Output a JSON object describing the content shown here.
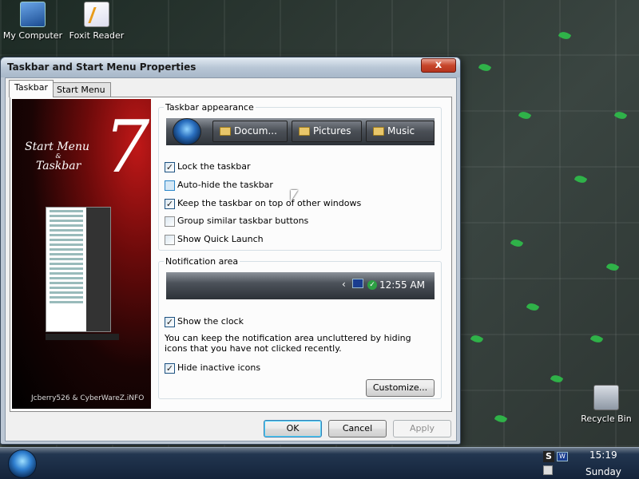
{
  "desktop": {
    "icons": [
      {
        "label": "My Computer",
        "icon": "my-computer-icon"
      },
      {
        "label": "Foxit Reader",
        "icon": "foxit-reader-icon"
      },
      {
        "label": "Recycle Bin",
        "icon": "recycle-bin-icon"
      }
    ]
  },
  "dialog": {
    "title": "Taskbar and Start Menu Properties",
    "close_label": "x",
    "tabs": [
      {
        "label": "Taskbar",
        "active": true
      },
      {
        "label": "Start Menu",
        "active": false
      }
    ],
    "preview": {
      "big_number": "7",
      "title_line1": "Start Menu",
      "title_amp": "&",
      "title_line2": "Taskbar",
      "credit": "Jcberry526 & CyberWareZ.iNFO"
    },
    "taskbar_appearance": {
      "label": "Taskbar appearance",
      "preview_buttons": [
        "Docum...",
        "Pictures",
        "Music"
      ],
      "options": [
        {
          "label": "Lock the taskbar",
          "checked": true
        },
        {
          "label": "Auto-hide the taskbar",
          "checked": false
        },
        {
          "label": "Keep the taskbar on top of other windows",
          "checked": true
        },
        {
          "label": "Group similar taskbar buttons",
          "checked": false
        },
        {
          "label": "Show Quick Launch",
          "checked": false
        }
      ]
    },
    "notification_area": {
      "label": "Notification area",
      "preview_time": "12:55 AM",
      "preview_arrow": "‹",
      "show_clock": {
        "label": "Show the clock",
        "checked": true
      },
      "note": "You can keep the notification area uncluttered by hiding icons that you have not clicked recently.",
      "hide_inactive": {
        "label": "Hide inactive icons",
        "checked": true
      },
      "customize_label": "Customize..."
    },
    "buttons": {
      "ok": "OK",
      "cancel": "Cancel",
      "apply": "Apply"
    }
  },
  "taskbar": {
    "clock_time": "15:19",
    "clock_day": "Sunday",
    "tray_icon1_glyph": "S",
    "tray_icon2_glyph": "W"
  },
  "colors": {
    "title_close": "#c7452a",
    "checkbox_border": "#1d5281",
    "default_button_border": "#3c7fb1"
  }
}
